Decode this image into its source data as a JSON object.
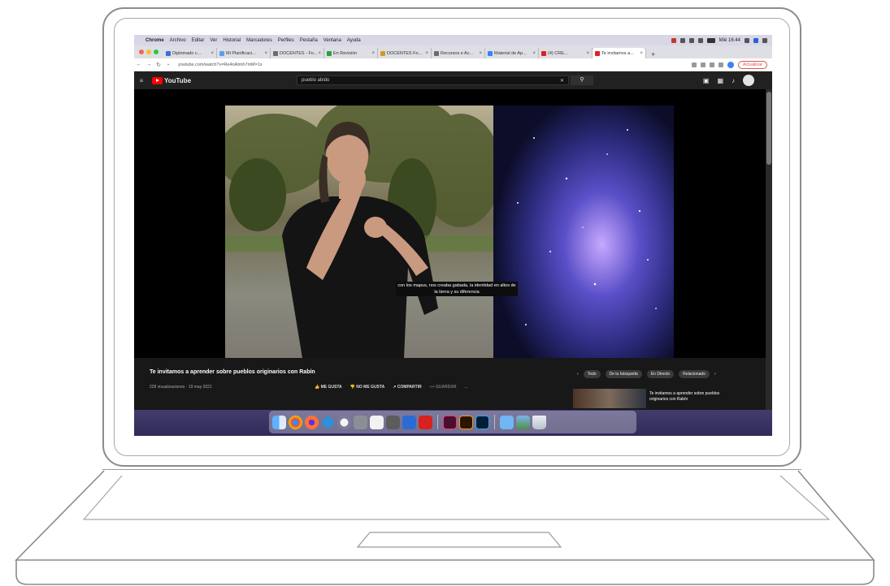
{
  "menubar": {
    "apple": "",
    "items": [
      "Chrome",
      "Archivo",
      "Editar",
      "Ver",
      "Historial",
      "Marcadores",
      "Perfiles",
      "Pestaña",
      "Ventana",
      "Ayuda"
    ],
    "clock": "Mié 16:44"
  },
  "tabs": [
    {
      "label": "Diplomado c...",
      "color": "#3b6fd6"
    },
    {
      "label": "Mi Planificaci...",
      "color": "#5aa0e8"
    },
    {
      "label": "DOCENTES - Fo...",
      "color": "#6c6c6c"
    },
    {
      "label": "En Revisión",
      "color": "#2ea043"
    },
    {
      "label": "DOCENTES Fo...",
      "color": "#d29922"
    },
    {
      "label": "Recursos e Ac...",
      "color": "#6c6c6c"
    },
    {
      "label": "Material de Ap...",
      "color": "#3b82f6"
    },
    {
      "label": "(4) CRE...",
      "color": "#e02020"
    },
    {
      "label": "Te invitamos a...",
      "color": "#e02020",
      "active": true
    }
  ],
  "address": {
    "url": "youtube.com/watch?v=Re4nAtmh7mM=1s",
    "update_label": "Actualizar"
  },
  "youtube": {
    "brand": "YouTube",
    "search_value": "pueblo abido",
    "caption": "con los mapus, nos creaba gabada, la identidad en altos de la tierra y su diferencia",
    "video_title": "Te invitamos a aprender sobre pueblos originarios con Rabín",
    "video_meta": "228 visualizaciones · 19 may 2021",
    "actions": [
      "ME GUSTA",
      "NO ME GUSTA",
      "COMPARTIR",
      "GUARDAR",
      "..."
    ],
    "chips": [
      "Todo",
      "De tu búsqueda",
      "En Directo",
      "Relacionado"
    ],
    "related_title": "Te invitamos a aprender sobre pueblos originarios con Rabín"
  },
  "dock_icons": [
    "finder-icon",
    "chrome-icon",
    "firefox-icon",
    "vscode-icon",
    "launchpad-icon",
    "system-prefs-icon",
    "notes-icon",
    "calculator-icon",
    "word-icon",
    "acrobat-icon",
    "indesign-icon",
    "illustrator-icon",
    "photoshop-icon",
    "folder-icon",
    "preview-icon",
    "trash-icon"
  ]
}
